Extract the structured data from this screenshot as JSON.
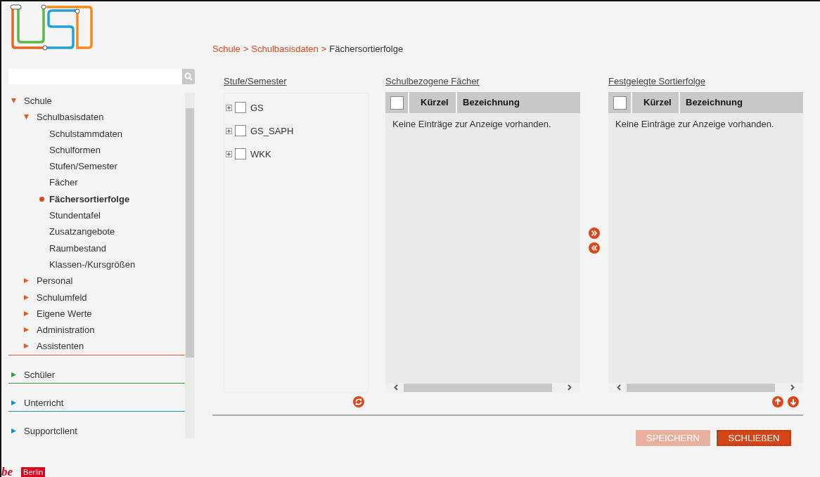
{
  "logo": {
    "mark": "be",
    "caption": "Berlin"
  },
  "nav": [
    {
      "label": "Schule",
      "color": "#e05a1e",
      "expanded": true,
      "children": [
        {
          "label": "Schulbasisdaten",
          "expanded": true,
          "children": [
            {
              "label": "Schulstammdaten",
              "selected": false
            },
            {
              "label": "Schulformen",
              "selected": false
            },
            {
              "label": "Stufen/Semester",
              "selected": false
            },
            {
              "label": "Fächer",
              "selected": false
            },
            {
              "label": "Fächersortierfolge",
              "selected": true
            },
            {
              "label": "Stundentafel",
              "selected": false
            },
            {
              "label": "Zusatzangebote",
              "selected": false
            },
            {
              "label": "Raumbestand",
              "selected": false
            },
            {
              "label": "Klassen-/Kursgrößen",
              "selected": false
            }
          ]
        },
        {
          "label": "Personal",
          "expanded": false
        },
        {
          "label": "Schulumfeld",
          "expanded": false
        },
        {
          "label": "Eigene Werte",
          "expanded": false
        },
        {
          "label": "Administration",
          "expanded": false
        },
        {
          "label": "Assistenten",
          "expanded": false
        }
      ]
    },
    {
      "label": "Schüler",
      "color": "#3a9a3a",
      "expanded": false
    },
    {
      "label": "Unterricht",
      "color": "#1e8bc3",
      "expanded": false
    },
    {
      "label": "Supportclient",
      "color": "#1e8bc3",
      "expanded": false
    }
  ],
  "breadcrumb": {
    "separator": ">",
    "items": [
      {
        "label": "Schule",
        "kind": "link"
      },
      {
        "label": "Schulbasisdaten",
        "kind": "link"
      },
      {
        "label": "Fächersortierfolge",
        "kind": "current"
      }
    ]
  },
  "stufen": {
    "title": "Stufe/Semester",
    "items": [
      {
        "label": "GS",
        "checked": false
      },
      {
        "label": "GS_SAPH",
        "checked": false
      },
      {
        "label": "WKK",
        "checked": false
      }
    ]
  },
  "tables": [
    {
      "title": "Schulbezogene Fächer",
      "all_checked": false,
      "columns": [
        "Kürzel",
        "Bezeichnung"
      ],
      "empty": "Keine Einträge zur Anzeige vorhanden."
    },
    {
      "title": "Festgelegte Sortierfolge",
      "all_checked": false,
      "columns": [
        "Kürzel",
        "Bezeichnung"
      ],
      "empty": "Keine Einträge zur Anzeige vorhanden."
    }
  ],
  "buttons": [
    {
      "label": "SPEICHERN",
      "disabled": true
    },
    {
      "label": "SCHLIEßEN",
      "disabled": false
    }
  ]
}
